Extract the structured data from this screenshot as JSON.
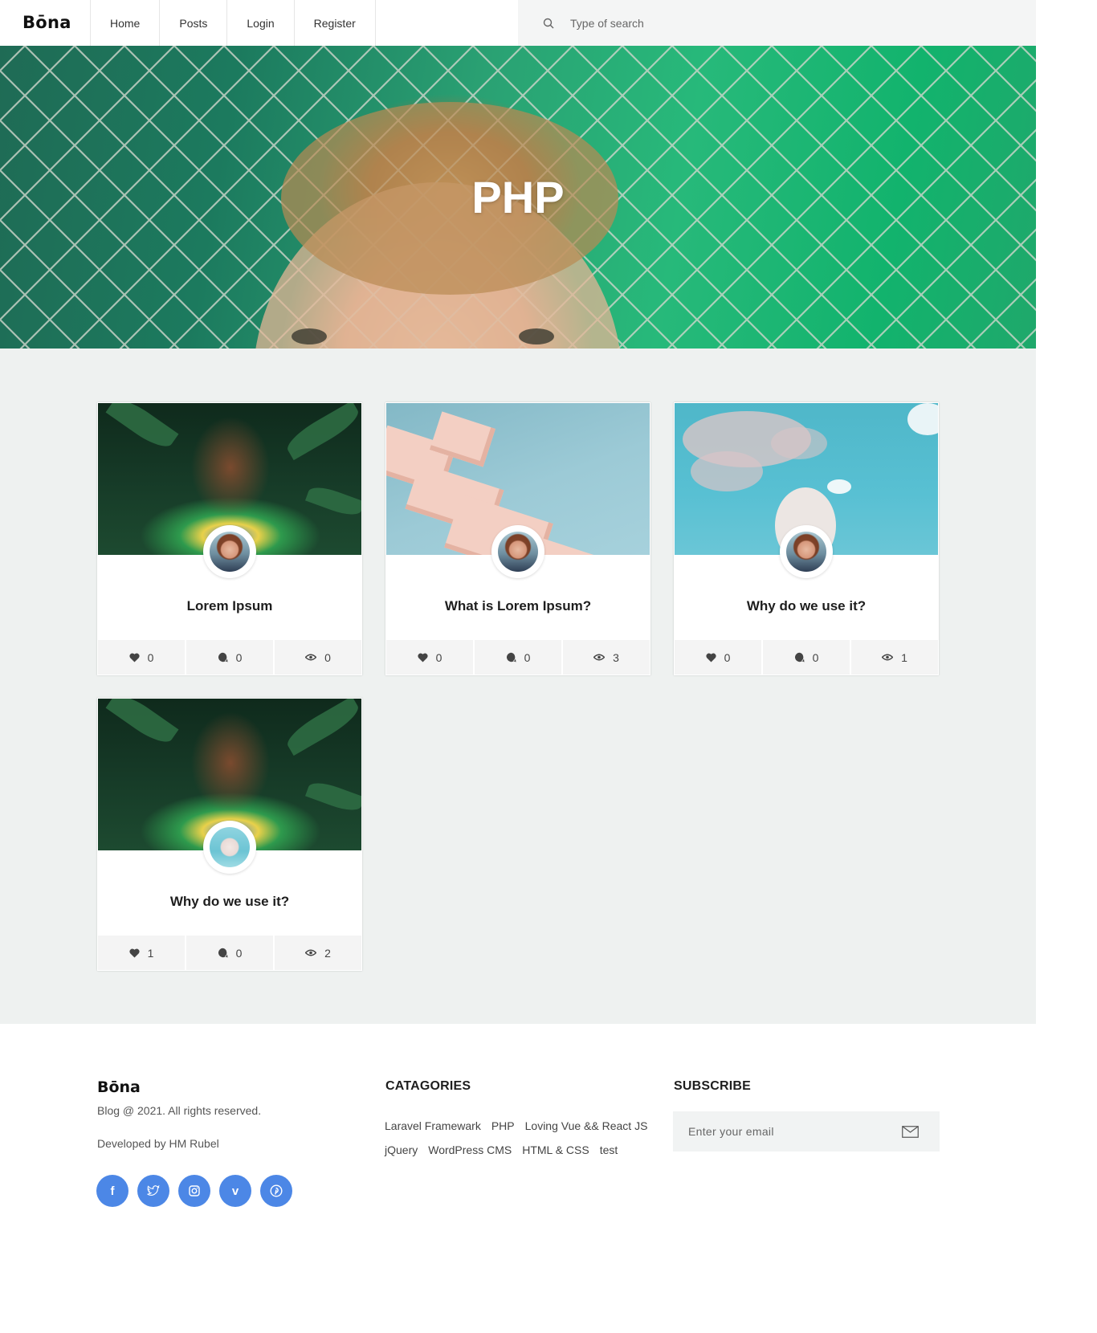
{
  "header": {
    "logo": "Bōna",
    "nav": [
      {
        "label": "Home"
      },
      {
        "label": "Posts"
      },
      {
        "label": "Login"
      },
      {
        "label": "Register"
      }
    ],
    "search": {
      "placeholder": "Type of search",
      "icon": "search-icon"
    }
  },
  "hero": {
    "title": "PHP"
  },
  "posts": [
    {
      "title": "Lorem Ipsum",
      "likes": "0",
      "comments": "0",
      "views": "0"
    },
    {
      "title": "What is Lorem Ipsum?",
      "likes": "0",
      "comments": "0",
      "views": "3"
    },
    {
      "title": "Why do we use it?",
      "likes": "0",
      "comments": "0",
      "views": "1"
    },
    {
      "title": "Why do we use it?",
      "likes": "1",
      "comments": "0",
      "views": "2"
    }
  ],
  "footer": {
    "logo": "Bōna",
    "copyright": "Blog @ 2021. All rights reserved.",
    "developer": "Developed by HM Rubel",
    "socials": [
      {
        "icon": "facebook-icon",
        "glyph": "f"
      },
      {
        "icon": "twitter-icon",
        "glyph": ""
      },
      {
        "icon": "instagram-icon",
        "glyph": ""
      },
      {
        "icon": "vimeo-icon",
        "glyph": "v"
      },
      {
        "icon": "pinterest-icon",
        "glyph": ""
      }
    ],
    "categories_heading": "CATAGORIES",
    "categories": [
      "Laravel Framewark",
      "PHP",
      "Loving Vue && React JS",
      "jQuery",
      "WordPress CMS",
      "HTML & CSS",
      "test"
    ],
    "subscribe_heading": "SUBSCRIBE",
    "subscribe_placeholder": "Enter your email"
  },
  "colors": {
    "social": "#4c87e6",
    "main_bg": "#eef1f0",
    "stats_bg": "#f4f4f4"
  }
}
